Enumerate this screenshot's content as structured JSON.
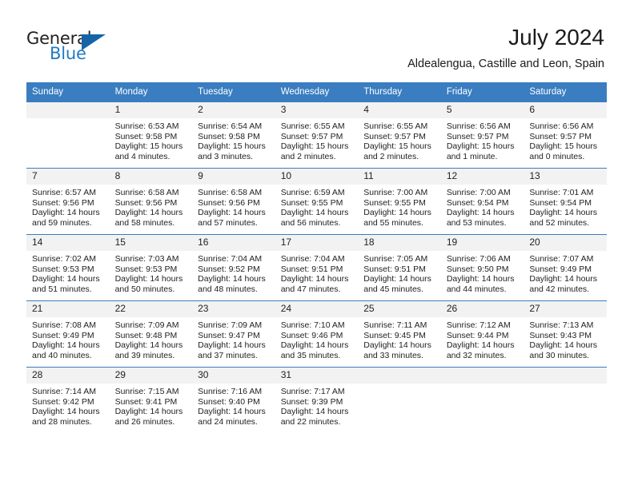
{
  "brand": {
    "name_dark": "General",
    "name_blue": "Blue",
    "accent_color": "#1f7ac4",
    "triangle_color": "#1565a6"
  },
  "header": {
    "title": "July 2024",
    "subtitle": "Aldealengua, Castille and Leon, Spain",
    "header_bg": "#3a7dc0"
  },
  "calendar": {
    "weekday_headers": [
      "Sunday",
      "Monday",
      "Tuesday",
      "Wednesday",
      "Thursday",
      "Friday",
      "Saturday"
    ],
    "weeks": [
      [
        {
          "day": "",
          "sunrise": "",
          "sunset": "",
          "daylight_1": "",
          "daylight_2": ""
        },
        {
          "day": "1",
          "sunrise": "Sunrise: 6:53 AM",
          "sunset": "Sunset: 9:58 PM",
          "daylight_1": "Daylight: 15 hours",
          "daylight_2": "and 4 minutes."
        },
        {
          "day": "2",
          "sunrise": "Sunrise: 6:54 AM",
          "sunset": "Sunset: 9:58 PM",
          "daylight_1": "Daylight: 15 hours",
          "daylight_2": "and 3 minutes."
        },
        {
          "day": "3",
          "sunrise": "Sunrise: 6:55 AM",
          "sunset": "Sunset: 9:57 PM",
          "daylight_1": "Daylight: 15 hours",
          "daylight_2": "and 2 minutes."
        },
        {
          "day": "4",
          "sunrise": "Sunrise: 6:55 AM",
          "sunset": "Sunset: 9:57 PM",
          "daylight_1": "Daylight: 15 hours",
          "daylight_2": "and 2 minutes."
        },
        {
          "day": "5",
          "sunrise": "Sunrise: 6:56 AM",
          "sunset": "Sunset: 9:57 PM",
          "daylight_1": "Daylight: 15 hours",
          "daylight_2": "and 1 minute."
        },
        {
          "day": "6",
          "sunrise": "Sunrise: 6:56 AM",
          "sunset": "Sunset: 9:57 PM",
          "daylight_1": "Daylight: 15 hours",
          "daylight_2": "and 0 minutes."
        }
      ],
      [
        {
          "day": "7",
          "sunrise": "Sunrise: 6:57 AM",
          "sunset": "Sunset: 9:56 PM",
          "daylight_1": "Daylight: 14 hours",
          "daylight_2": "and 59 minutes."
        },
        {
          "day": "8",
          "sunrise": "Sunrise: 6:58 AM",
          "sunset": "Sunset: 9:56 PM",
          "daylight_1": "Daylight: 14 hours",
          "daylight_2": "and 58 minutes."
        },
        {
          "day": "9",
          "sunrise": "Sunrise: 6:58 AM",
          "sunset": "Sunset: 9:56 PM",
          "daylight_1": "Daylight: 14 hours",
          "daylight_2": "and 57 minutes."
        },
        {
          "day": "10",
          "sunrise": "Sunrise: 6:59 AM",
          "sunset": "Sunset: 9:55 PM",
          "daylight_1": "Daylight: 14 hours",
          "daylight_2": "and 56 minutes."
        },
        {
          "day": "11",
          "sunrise": "Sunrise: 7:00 AM",
          "sunset": "Sunset: 9:55 PM",
          "daylight_1": "Daylight: 14 hours",
          "daylight_2": "and 55 minutes."
        },
        {
          "day": "12",
          "sunrise": "Sunrise: 7:00 AM",
          "sunset": "Sunset: 9:54 PM",
          "daylight_1": "Daylight: 14 hours",
          "daylight_2": "and 53 minutes."
        },
        {
          "day": "13",
          "sunrise": "Sunrise: 7:01 AM",
          "sunset": "Sunset: 9:54 PM",
          "daylight_1": "Daylight: 14 hours",
          "daylight_2": "and 52 minutes."
        }
      ],
      [
        {
          "day": "14",
          "sunrise": "Sunrise: 7:02 AM",
          "sunset": "Sunset: 9:53 PM",
          "daylight_1": "Daylight: 14 hours",
          "daylight_2": "and 51 minutes."
        },
        {
          "day": "15",
          "sunrise": "Sunrise: 7:03 AM",
          "sunset": "Sunset: 9:53 PM",
          "daylight_1": "Daylight: 14 hours",
          "daylight_2": "and 50 minutes."
        },
        {
          "day": "16",
          "sunrise": "Sunrise: 7:04 AM",
          "sunset": "Sunset: 9:52 PM",
          "daylight_1": "Daylight: 14 hours",
          "daylight_2": "and 48 minutes."
        },
        {
          "day": "17",
          "sunrise": "Sunrise: 7:04 AM",
          "sunset": "Sunset: 9:51 PM",
          "daylight_1": "Daylight: 14 hours",
          "daylight_2": "and 47 minutes."
        },
        {
          "day": "18",
          "sunrise": "Sunrise: 7:05 AM",
          "sunset": "Sunset: 9:51 PM",
          "daylight_1": "Daylight: 14 hours",
          "daylight_2": "and 45 minutes."
        },
        {
          "day": "19",
          "sunrise": "Sunrise: 7:06 AM",
          "sunset": "Sunset: 9:50 PM",
          "daylight_1": "Daylight: 14 hours",
          "daylight_2": "and 44 minutes."
        },
        {
          "day": "20",
          "sunrise": "Sunrise: 7:07 AM",
          "sunset": "Sunset: 9:49 PM",
          "daylight_1": "Daylight: 14 hours",
          "daylight_2": "and 42 minutes."
        }
      ],
      [
        {
          "day": "21",
          "sunrise": "Sunrise: 7:08 AM",
          "sunset": "Sunset: 9:49 PM",
          "daylight_1": "Daylight: 14 hours",
          "daylight_2": "and 40 minutes."
        },
        {
          "day": "22",
          "sunrise": "Sunrise: 7:09 AM",
          "sunset": "Sunset: 9:48 PM",
          "daylight_1": "Daylight: 14 hours",
          "daylight_2": "and 39 minutes."
        },
        {
          "day": "23",
          "sunrise": "Sunrise: 7:09 AM",
          "sunset": "Sunset: 9:47 PM",
          "daylight_1": "Daylight: 14 hours",
          "daylight_2": "and 37 minutes."
        },
        {
          "day": "24",
          "sunrise": "Sunrise: 7:10 AM",
          "sunset": "Sunset: 9:46 PM",
          "daylight_1": "Daylight: 14 hours",
          "daylight_2": "and 35 minutes."
        },
        {
          "day": "25",
          "sunrise": "Sunrise: 7:11 AM",
          "sunset": "Sunset: 9:45 PM",
          "daylight_1": "Daylight: 14 hours",
          "daylight_2": "and 33 minutes."
        },
        {
          "day": "26",
          "sunrise": "Sunrise: 7:12 AM",
          "sunset": "Sunset: 9:44 PM",
          "daylight_1": "Daylight: 14 hours",
          "daylight_2": "and 32 minutes."
        },
        {
          "day": "27",
          "sunrise": "Sunrise: 7:13 AM",
          "sunset": "Sunset: 9:43 PM",
          "daylight_1": "Daylight: 14 hours",
          "daylight_2": "and 30 minutes."
        }
      ],
      [
        {
          "day": "28",
          "sunrise": "Sunrise: 7:14 AM",
          "sunset": "Sunset: 9:42 PM",
          "daylight_1": "Daylight: 14 hours",
          "daylight_2": "and 28 minutes."
        },
        {
          "day": "29",
          "sunrise": "Sunrise: 7:15 AM",
          "sunset": "Sunset: 9:41 PM",
          "daylight_1": "Daylight: 14 hours",
          "daylight_2": "and 26 minutes."
        },
        {
          "day": "30",
          "sunrise": "Sunrise: 7:16 AM",
          "sunset": "Sunset: 9:40 PM",
          "daylight_1": "Daylight: 14 hours",
          "daylight_2": "and 24 minutes."
        },
        {
          "day": "31",
          "sunrise": "Sunrise: 7:17 AM",
          "sunset": "Sunset: 9:39 PM",
          "daylight_1": "Daylight: 14 hours",
          "daylight_2": "and 22 minutes."
        },
        {
          "day": "",
          "sunrise": "",
          "sunset": "",
          "daylight_1": "",
          "daylight_2": ""
        },
        {
          "day": "",
          "sunrise": "",
          "sunset": "",
          "daylight_1": "",
          "daylight_2": ""
        },
        {
          "day": "",
          "sunrise": "",
          "sunset": "",
          "daylight_1": "",
          "daylight_2": ""
        }
      ]
    ]
  }
}
